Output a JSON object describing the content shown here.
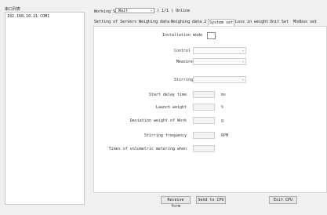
{
  "left_panel": {
    "title": "串口列表",
    "devices": [
      "192.168.10.21 COM1"
    ]
  },
  "status": {
    "label": "Working Status",
    "value": "Wait",
    "online": "( 1/1 ) Online"
  },
  "tabs": [
    {
      "label": "Setting of Servers",
      "active": false
    },
    {
      "label": "Weighing data",
      "active": false
    },
    {
      "label": "Weighing data 2",
      "active": false
    },
    {
      "label": "System set",
      "active": true
    },
    {
      "label": "Loss in weight",
      "active": false
    },
    {
      "label": "Unit Set",
      "active": false
    },
    {
      "label": "Modbus set",
      "active": false
    }
  ],
  "form": {
    "installation_mode_label": "Installation mode",
    "control_mode_label": "Control mode",
    "measure_way_label": "Measure way",
    "stirring_way_label": "Stirring way",
    "start_delay_time_label": "Start delay time",
    "start_delay_time_unit": "ms",
    "launch_weight_label": "Launch weight",
    "launch_weight_unit": "%",
    "deviation_weight_label": "Deviation weight of Work",
    "deviation_weight_unit": "g",
    "stirring_frequency_label": "Stirring frequency",
    "stirring_frequency_unit": "RPM",
    "times_volumetric_label": "Times of volumetric metering when"
  },
  "buttons": {
    "receive": "Receive form",
    "send": "Send to CPU",
    "exit": "Exit CPU"
  }
}
